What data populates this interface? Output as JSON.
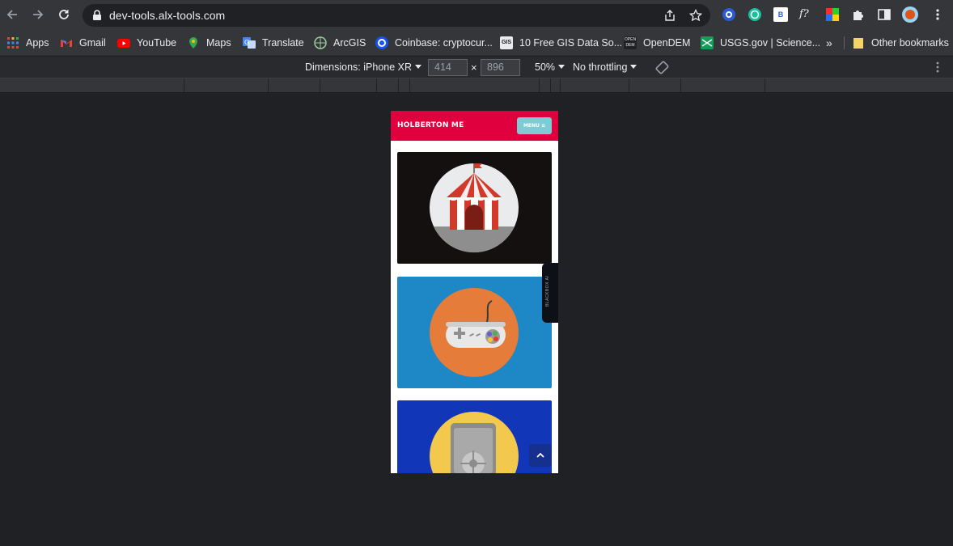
{
  "browser": {
    "url": "dev-tools.alx-tools.com",
    "bookmarks": [
      {
        "label": "Apps",
        "icon": "apps-grid-icon"
      },
      {
        "label": "Gmail",
        "icon": "gmail-icon"
      },
      {
        "label": "YouTube",
        "icon": "youtube-icon"
      },
      {
        "label": "Maps",
        "icon": "maps-icon"
      },
      {
        "label": "Translate",
        "icon": "translate-icon"
      },
      {
        "label": "ArcGIS",
        "icon": "arcgis-icon"
      },
      {
        "label": "Coinbase: cryptocur...",
        "icon": "coinbase-icon"
      },
      {
        "label": "10 Free GIS Data So...",
        "icon": "gis-icon"
      },
      {
        "label": "OpenDEM",
        "icon": "opendem-icon"
      },
      {
        "label": "USGS.gov | Science...",
        "icon": "usgs-icon"
      }
    ],
    "overflow": "»",
    "other_bookmarks": "Other bookmarks",
    "gis_icon_text": "GIS",
    "opendem_icon_text": "OPEN DEM",
    "ext_b_text": "B",
    "ext_f_text": "f?"
  },
  "device_toolbar": {
    "dimensions_label": "Dimensions: iPhone XR",
    "width": "414",
    "height": "896",
    "times": "×",
    "zoom": "50%",
    "throttling": "No throttling"
  },
  "site": {
    "title": "HOLBERTON ME",
    "menu_label": "MENU ≡",
    "cards": [
      {
        "name": "circus-tent-card",
        "bg": "#141010"
      },
      {
        "name": "gamepad-card",
        "bg": "#1e87c6"
      },
      {
        "name": "safe-card",
        "bg": "#1236b8"
      }
    ],
    "header_color": "#e0003d"
  },
  "side_tab": {
    "label": "BLACKBOX AI"
  }
}
